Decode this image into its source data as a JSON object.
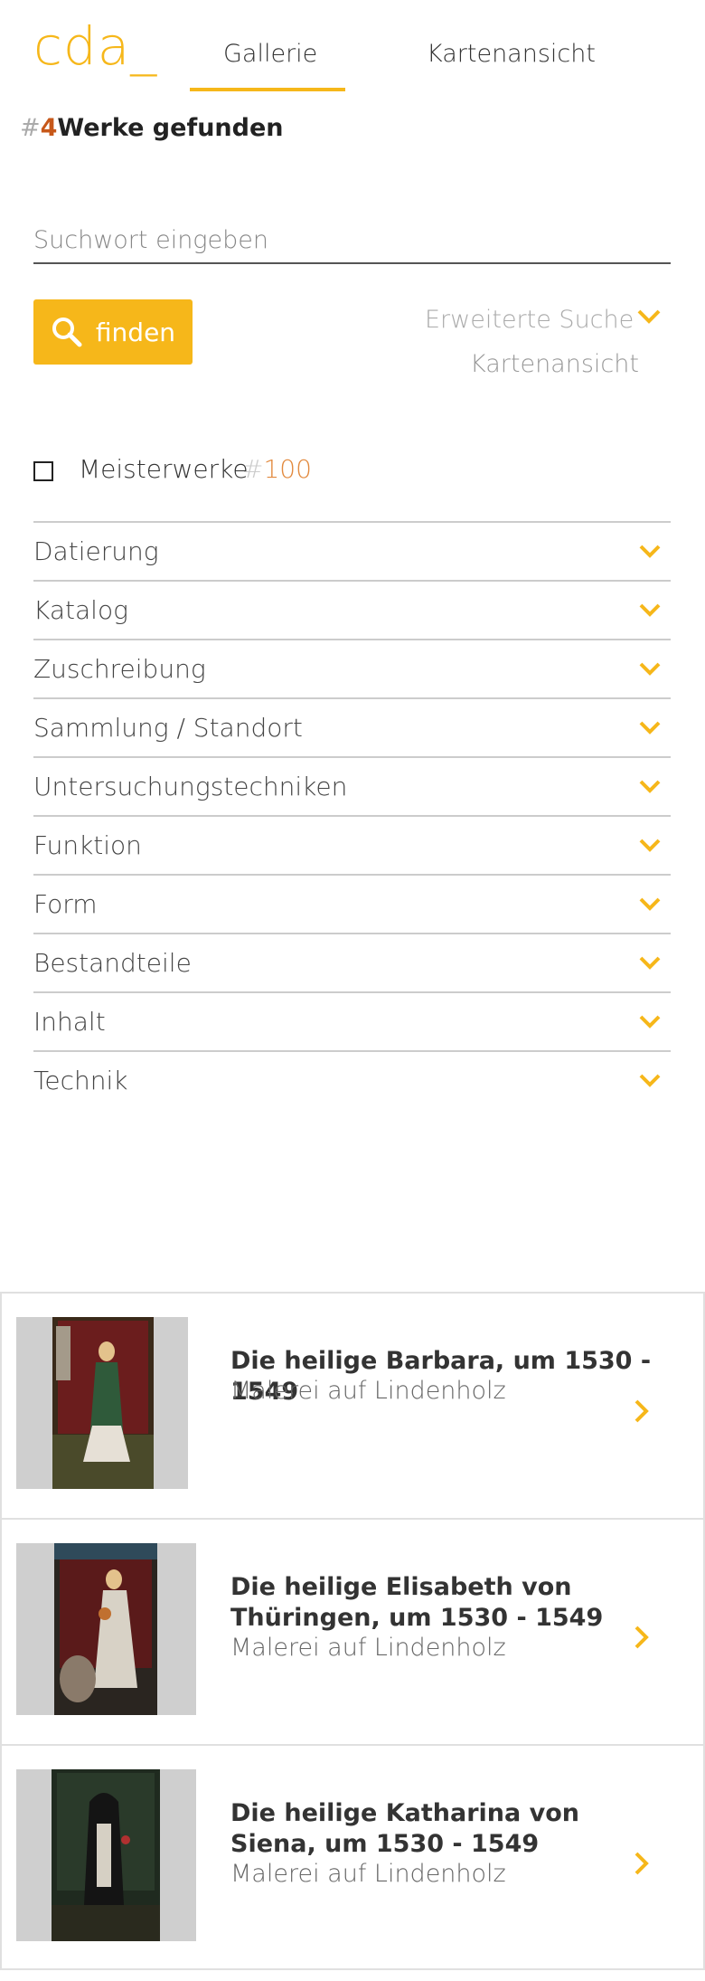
{
  "header": {
    "logo": "cda_",
    "tabs": [
      {
        "label": "Gallerie",
        "active": true
      },
      {
        "label": "Kartenansicht",
        "active": false
      }
    ]
  },
  "result": {
    "hash": "#",
    "count": "4",
    "label": "Werke gefunden"
  },
  "search": {
    "placeholder": "Suchwort eingeben",
    "value": "",
    "button_label": "finden",
    "advanced_label": "Erweiterte Suche",
    "map_label": "Kartenansicht"
  },
  "masterworks": {
    "label": "Meisterwerke",
    "hash": "#",
    "count": "100",
    "checked": false
  },
  "filters": [
    "Datierung",
    "Katalog",
    "Zuschreibung",
    "Sammlung / Standort",
    "Untersuchungstechniken",
    "Funktion",
    "Form",
    "Bestandteile",
    "Inhalt",
    "Technik"
  ],
  "works": [
    {
      "title": "Die heilige Barbara, um 1530 - 1549",
      "subtitle": "Malerei auf Lindenholz"
    },
    {
      "title": "Die heilige Elisabeth von Thüringen, um 1530 - 1549",
      "subtitle": "Malerei auf Lindenholz"
    },
    {
      "title": "Die heilige Katharina von Siena, um 1530 - 1549",
      "subtitle": "Malerei auf Lindenholz"
    }
  ],
  "colors": {
    "accent": "#f6b71a",
    "count": "#c7581a",
    "masterwork_count": "#e2893d"
  }
}
